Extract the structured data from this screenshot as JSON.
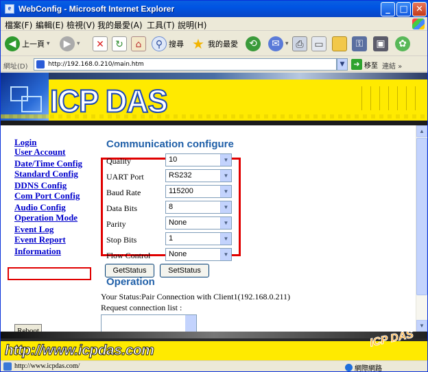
{
  "window": {
    "title": "WebConfig - Microsoft Internet Explorer",
    "min_label": "_",
    "max_label": "□",
    "close_label": "✕"
  },
  "menubar": {
    "items": [
      "檔案(F)",
      "編輯(E)",
      "檢視(V)",
      "我的最愛(A)",
      "工具(T)",
      "說明(H)"
    ]
  },
  "toolbar": {
    "back_label": "上一頁",
    "search_label": "搜尋",
    "favorites_label": "我的最愛"
  },
  "addressbar": {
    "label": "網址(D)",
    "url": "http://192.168.0.210/main.htm",
    "go_label": "移至",
    "links_label": "連結"
  },
  "banner": {
    "logo_text": "ICP DAS"
  },
  "nav": {
    "links": [
      "Login",
      "User Account",
      "Date/Time Config",
      "Standard Config",
      "DDNS Config",
      "Com Port Config",
      "Audio Config",
      "Operation Mode",
      "Event Log",
      "Event Report",
      "Information"
    ],
    "selected": "Operation Mode",
    "reboot_label": "Reboot"
  },
  "main": {
    "heading": "Communication configure",
    "fields": [
      {
        "label": "Quality",
        "value": "10"
      },
      {
        "label": "UART Port",
        "value": "RS232"
      },
      {
        "label": "Baud Rate",
        "value": "115200"
      },
      {
        "label": "Data Bits",
        "value": "8"
      },
      {
        "label": "Parity",
        "value": "None"
      },
      {
        "label": "Stop Bits",
        "value": "1"
      },
      {
        "label": "Flow Control",
        "value": "None"
      }
    ],
    "getstatus_label": "GetStatus",
    "setstatus_label": "SetStatus",
    "operation_heading": "Operation",
    "status_text": "Your Status:Pair Connection with Client1(192.168.0.211)",
    "request_label": "Request connection list :"
  },
  "footer": {
    "url_text": "http://www.icpdas.com",
    "logo_text": "ICP DAS"
  },
  "statusbar": {
    "text": "http://www.icpdas.com/",
    "zone": "網際網路"
  },
  "colors": {
    "accent": "#1f5fa8",
    "link": "#0000cc",
    "highlight_border": "#e00000",
    "banner_yellow": "#ffea00"
  }
}
